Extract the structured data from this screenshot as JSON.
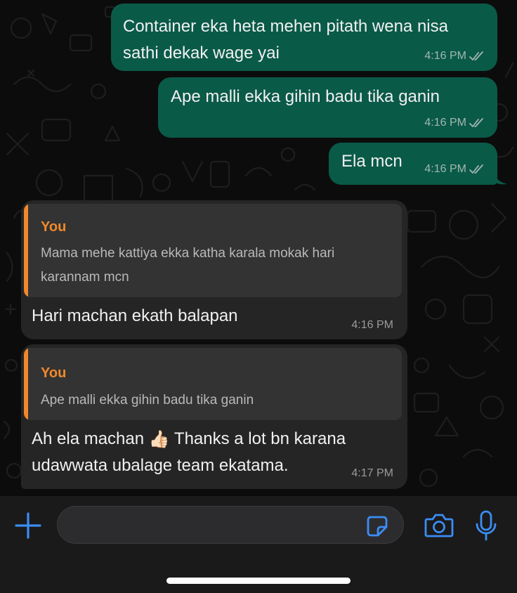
{
  "messages": [
    {
      "direction": "outgoing",
      "lines": [
        "Container eka heta mehen pitath wena nisa",
        "sathi dekak wage yai"
      ],
      "time": "4:16 PM",
      "status": "read"
    },
    {
      "direction": "outgoing",
      "lines": [
        "Ape malli ekka gihin badu tika ganin"
      ],
      "time": "4:16 PM",
      "status": "read"
    },
    {
      "direction": "outgoing",
      "lines": [
        "Ela mcn"
      ],
      "time": "4:16 PM",
      "status": "read"
    },
    {
      "direction": "incoming",
      "quote": {
        "author": "You",
        "lines": [
          "Mama mehe kattiya ekka katha karala mokak hari",
          "karannam mcn"
        ]
      },
      "lines": [
        "Hari machan ekath balapan"
      ],
      "time": "4:16 PM"
    },
    {
      "direction": "incoming",
      "quote": {
        "author": "You",
        "lines": [
          "Ape malli ekka gihin badu tika ganin"
        ]
      },
      "line1_start": "Ah ela machan",
      "emoji": "👍🏻",
      "line1_end": "Thanks a lot bn karana",
      "line2": "udawwata ubalage team ekatama.",
      "time": "4:17 PM"
    }
  ],
  "composer": {
    "value": "",
    "placeholder": ""
  },
  "colors": {
    "outgoing_bubble": "#0a5a48",
    "incoming_bubble": "#252525",
    "quote_accent": "#f1882b",
    "icon_accent": "#3b8df5"
  },
  "icons": {
    "attach": "plus-icon",
    "sticker": "sticker-icon",
    "camera": "camera-icon",
    "mic": "microphone-icon",
    "read_receipt": "double-check-icon"
  }
}
